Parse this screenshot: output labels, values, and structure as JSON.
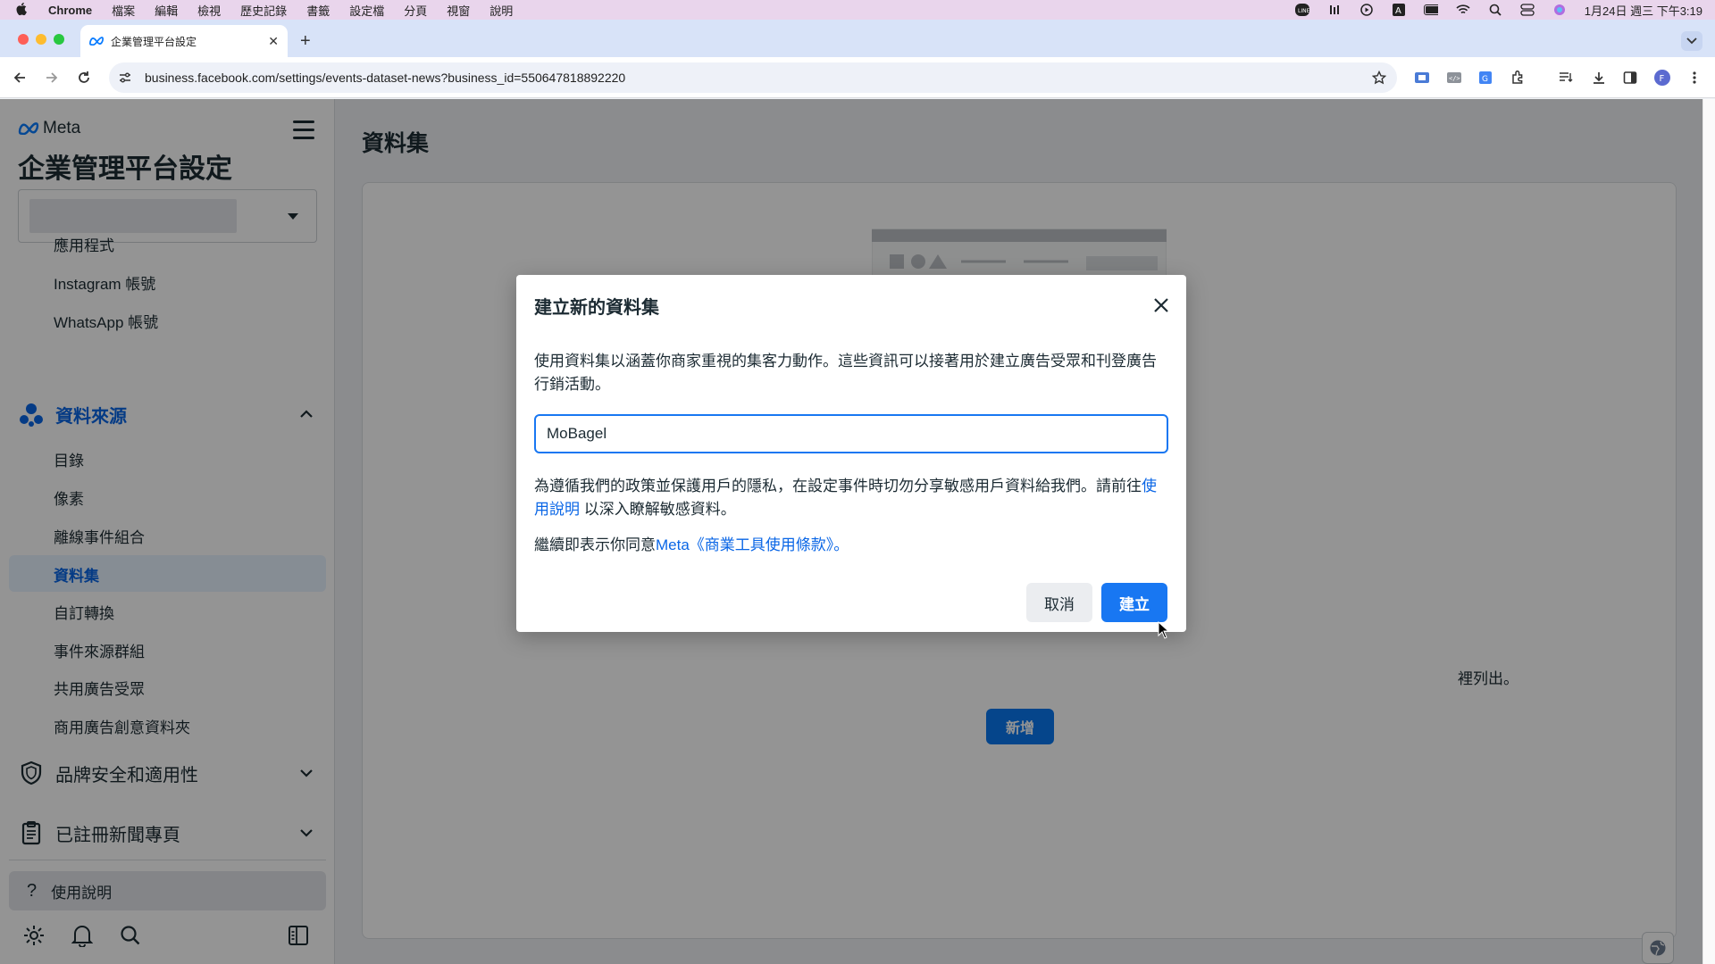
{
  "menubar": {
    "app": "Chrome",
    "items": [
      "檔案",
      "編輯",
      "檢視",
      "歷史記錄",
      "書籤",
      "設定檔",
      "分頁",
      "視窗",
      "說明"
    ],
    "clock": "1月24日 週三 下午3:19"
  },
  "browser": {
    "tab_title": "企業管理平台設定",
    "url": "business.facebook.com/settings/events-dataset-news?business_id=550647818892220"
  },
  "sidebar": {
    "brand": "Meta",
    "title": "企業管理平台設定",
    "items_top": [
      "應用程式",
      "Instagram 帳號",
      "WhatsApp 帳號"
    ],
    "section_data_sources": "資料來源",
    "data_source_items": [
      "目錄",
      "像素",
      "離線事件組合",
      "資料集",
      "自訂轉換",
      "事件來源群組",
      "共用廣告受眾",
      "商用廣告創意資料夾"
    ],
    "section_brand_safety": "品牌安全和適用性",
    "section_news": "已註冊新聞專頁",
    "help": "使用說明"
  },
  "main": {
    "title": "資料集",
    "empty_text_visible": "裡列出。",
    "add_button": "新增"
  },
  "modal": {
    "title": "建立新的資料集",
    "description": "使用資料集以涵蓋你商家重視的集客力動作。這些資訊可以接著用於建立廣告受眾和刊登廣告行銷活動。",
    "input_value": "MoBagel",
    "privacy_text_before": "為遵循我們的政策並保護用戶的隱私，在設定事件時切勿分享敏感用戶資料給我們。請前往",
    "privacy_link": "使用說明",
    "privacy_text_after": " 以深入瞭解敏感資料。",
    "terms_text": "繼續即表示你同意",
    "terms_link": "Meta《商業工具使用條款》。",
    "cancel": "取消",
    "create": "建立"
  },
  "colors": {
    "accent": "#1877f2",
    "active_text": "#0a66e6",
    "menubar_bg": "#e9d5ec",
    "tabstrip_bg": "#d8e3f8"
  }
}
